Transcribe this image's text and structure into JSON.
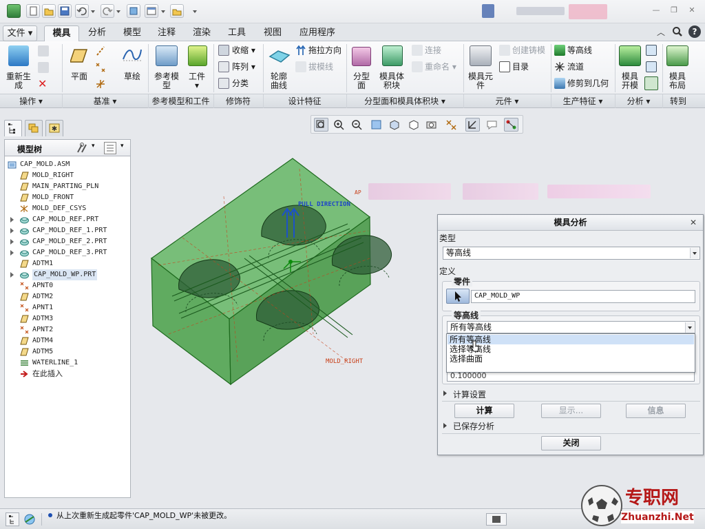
{
  "tabs": [
    {
      "label": "文件"
    },
    {
      "label": "模具"
    },
    {
      "label": "分析"
    },
    {
      "label": "模型"
    },
    {
      "label": "注释"
    },
    {
      "label": "渲染"
    },
    {
      "label": "工具"
    },
    {
      "label": "视图"
    },
    {
      "label": "应用程序"
    }
  ],
  "ribbon": {
    "regenerate": "重新生\n成",
    "plane": "平面",
    "sketch": "草绘",
    "ref_model": "参考模\n型",
    "workpiece": "工件",
    "shrink": "收缩",
    "pattern": "阵列",
    "classify": "分类",
    "outline_curve": "轮廓\n曲线",
    "draw_direction": "拖拉方向",
    "draft_line": "拔模线",
    "parting_surface": "分型\n面",
    "mold_volume": "模具体\n积块",
    "connect": "连接",
    "rename": "重命名",
    "mold_component": "模具元\n件",
    "create_casting": "创建铸模",
    "catalog": "目录",
    "contour": "等高线",
    "runner": "流道",
    "trim_geometry": "修剪到几何",
    "mold_open": "模具\n开模",
    "mold_layout": "模具\n布局"
  },
  "groups": {
    "operations": "操作",
    "datum": "基准",
    "ref_model_workpiece": "参考模型和工件",
    "modifiers": "修饰符",
    "design_features": "设计特征",
    "parting_volume": "分型面和模具体积块",
    "components": "元件",
    "production_features": "生产特征",
    "analysis": "分析",
    "goto": "转到"
  },
  "tree": {
    "title": "模型树",
    "items": [
      {
        "label": "CAP_MOLD.ASM",
        "icon": "assembly-icon",
        "expander": false,
        "indent": 0
      },
      {
        "label": "MOLD_RIGHT",
        "icon": "datum-plane-icon",
        "expander": false,
        "indent": 1
      },
      {
        "label": "MAIN_PARTING_PLN",
        "icon": "datum-plane-icon",
        "expander": false,
        "indent": 1
      },
      {
        "label": "MOLD_FRONT",
        "icon": "datum-plane-icon",
        "expander": false,
        "indent": 1
      },
      {
        "label": "MOLD_DEF_CSYS",
        "icon": "csys-icon",
        "expander": false,
        "indent": 1
      },
      {
        "label": "CAP_MOLD_REF.PRT",
        "icon": "part-icon",
        "expander": true,
        "indent": 1
      },
      {
        "label": "CAP_MOLD_REF_1.PRT",
        "icon": "part-icon",
        "expander": true,
        "indent": 1
      },
      {
        "label": "CAP_MOLD_REF_2.PRT",
        "icon": "part-icon",
        "expander": true,
        "indent": 1
      },
      {
        "label": "CAP_MOLD_REF_3.PRT",
        "icon": "part-icon",
        "expander": true,
        "indent": 1
      },
      {
        "label": "ADTM1",
        "icon": "datum-plane-icon",
        "expander": false,
        "indent": 1
      },
      {
        "label": "CAP_MOLD_WP.PRT",
        "icon": "part-icon",
        "expander": true,
        "indent": 1,
        "selected": true
      },
      {
        "label": "APNT0",
        "icon": "datum-point-icon",
        "expander": false,
        "indent": 1
      },
      {
        "label": "ADTM2",
        "icon": "datum-plane-icon",
        "expander": false,
        "indent": 1
      },
      {
        "label": "APNT1",
        "icon": "datum-point-icon",
        "expander": false,
        "indent": 1
      },
      {
        "label": "ADTM3",
        "icon": "datum-plane-icon",
        "expander": false,
        "indent": 1
      },
      {
        "label": "APNT2",
        "icon": "datum-point-icon",
        "expander": false,
        "indent": 1
      },
      {
        "label": "ADTM4",
        "icon": "datum-plane-icon",
        "expander": false,
        "indent": 1
      },
      {
        "label": "ADTM5",
        "icon": "datum-plane-icon",
        "expander": false,
        "indent": 1
      },
      {
        "label": "WATERLINE_1",
        "icon": "waterline-icon",
        "expander": false,
        "indent": 1
      },
      {
        "label": "在此插入",
        "icon": "insert-arrow-icon",
        "expander": false,
        "indent": 1
      }
    ]
  },
  "viewport": {
    "pull_direction": "PULL DIRECTION",
    "mold_right": "MOLD_RIGHT",
    "workpiece_color": "#3aa33a"
  },
  "dialog": {
    "title": "模具分析",
    "type_label": "类型",
    "type_value": "等高线",
    "definition_label": "定义",
    "part_label": "零件",
    "part_value": "CAP_MOLD_WP",
    "contour_label": "等高线",
    "contour_value": "所有等高线",
    "options": [
      "所有等高线",
      "选择等高线",
      "选择曲面"
    ],
    "selected_option": 0,
    "partial_value": "0.100000",
    "calc_settings": "计算设置",
    "calc_button": "计算",
    "show_button": "显示...",
    "info_button": "信息",
    "saved_analysis": "已保存分析",
    "close_button": "关闭"
  },
  "status": {
    "message": "从上次重新生成起零件'CAP_MOLD_WP'未被更改。"
  },
  "watermark": {
    "cn": "专职网",
    "url": "Zhuanzhi.Net"
  }
}
